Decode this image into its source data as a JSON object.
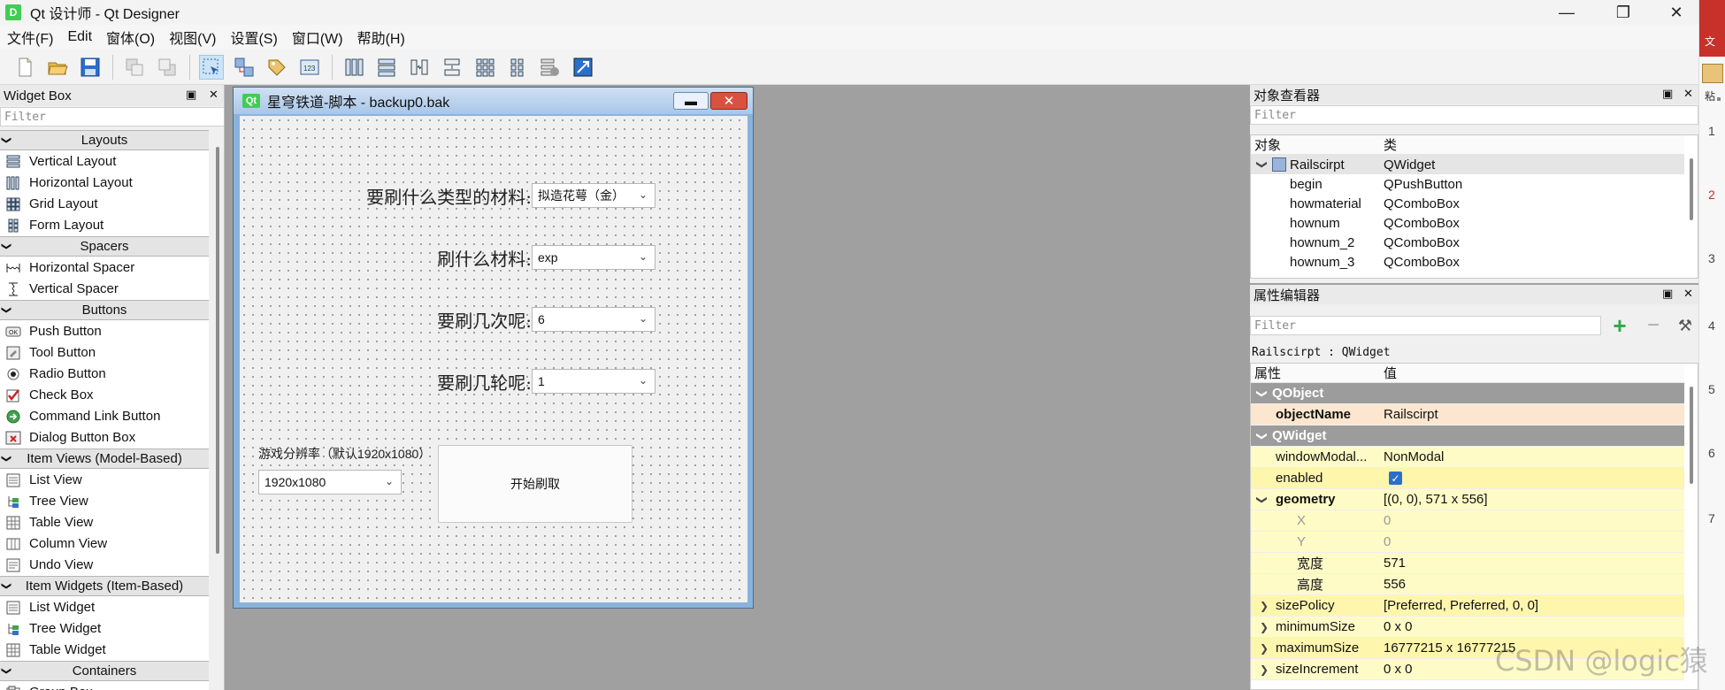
{
  "window": {
    "app_icon": "D",
    "title": "Qt 设计师 - Qt Designer",
    "minimize": "—",
    "restore": "❐",
    "close": "✕"
  },
  "menu": [
    "文件(F)",
    "Edit",
    "窗体(O)",
    "视图(V)",
    "设置(S)",
    "窗口(W)",
    "帮助(H)"
  ],
  "toolbar": {
    "icons": [
      "new-form-icon",
      "open-icon",
      "save-icon",
      "send-to-back-icon",
      "bring-to-front-icon",
      "edit-widgets-icon",
      "edit-signals-slots-icon",
      "edit-buddies-icon",
      "edit-tab-order-icon",
      "layout-horizontal-icon",
      "layout-vertical-icon",
      "layout-h-splitter-icon",
      "layout-v-splitter-icon",
      "layout-grid-icon",
      "layout-form-icon",
      "break-layout-icon",
      "adjust-size-icon"
    ]
  },
  "widget_box": {
    "title": "Widget Box",
    "filter_placeholder": "Filter",
    "float_icon": "▣",
    "close_icon": "✕",
    "rows": [
      {
        "type": "cat",
        "label": "Layouts"
      },
      {
        "type": "item",
        "label": "Vertical Layout",
        "icon": "vertical-layout-icon"
      },
      {
        "type": "item",
        "label": "Horizontal Layout",
        "icon": "horizontal-layout-icon"
      },
      {
        "type": "item",
        "label": "Grid Layout",
        "icon": "grid-layout-icon"
      },
      {
        "type": "item",
        "label": "Form Layout",
        "icon": "form-layout-icon"
      },
      {
        "type": "cat",
        "label": "Spacers"
      },
      {
        "type": "item",
        "label": "Horizontal Spacer",
        "icon": "horizontal-spacer-icon"
      },
      {
        "type": "item",
        "label": "Vertical Spacer",
        "icon": "vertical-spacer-icon"
      },
      {
        "type": "cat",
        "label": "Buttons"
      },
      {
        "type": "item",
        "label": "Push Button",
        "icon": "push-button-icon"
      },
      {
        "type": "item",
        "label": "Tool Button",
        "icon": "tool-button-icon"
      },
      {
        "type": "item",
        "label": "Radio Button",
        "icon": "radio-button-icon"
      },
      {
        "type": "item",
        "label": "Check Box",
        "icon": "check-box-icon"
      },
      {
        "type": "item",
        "label": "Command Link Button",
        "icon": "command-link-icon"
      },
      {
        "type": "item",
        "label": "Dialog Button Box",
        "icon": "dialog-button-box-icon"
      },
      {
        "type": "cat",
        "label": "Item Views (Model-Based)"
      },
      {
        "type": "item",
        "label": "List View",
        "icon": "list-view-icon"
      },
      {
        "type": "item",
        "label": "Tree View",
        "icon": "tree-view-icon"
      },
      {
        "type": "item",
        "label": "Table View",
        "icon": "table-view-icon"
      },
      {
        "type": "item",
        "label": "Column View",
        "icon": "column-view-icon"
      },
      {
        "type": "item",
        "label": "Undo View",
        "icon": "undo-view-icon"
      },
      {
        "type": "cat",
        "label": "Item Widgets (Item-Based)"
      },
      {
        "type": "item",
        "label": "List Widget",
        "icon": "list-widget-icon"
      },
      {
        "type": "item",
        "label": "Tree Widget",
        "icon": "tree-widget-icon"
      },
      {
        "type": "item",
        "label": "Table Widget",
        "icon": "table-widget-icon"
      },
      {
        "type": "cat",
        "label": "Containers"
      },
      {
        "type": "item",
        "label": "Group Box",
        "icon": "group-box-icon"
      }
    ]
  },
  "form": {
    "qt_badge": "Qt",
    "title": "星穹铁道-脚本 - backup0.bak",
    "labels": {
      "material_type": "要刷什么类型的材料:",
      "material": "刷什么材料:",
      "times": "要刷几次呢:",
      "rounds": "要刷几轮呢:",
      "resolution": "游戏分辨率（默认1920x1080）"
    },
    "combos": {
      "material_type": "拟造花萼（金）",
      "material": "exp",
      "times": "6",
      "rounds": "1",
      "resolution": "1920x1080"
    },
    "start_button": "开始刷取"
  },
  "object_inspector": {
    "title": "对象查看器",
    "filter_placeholder": "Filter",
    "col_object": "对象",
    "col_class": "类",
    "rows": [
      {
        "object": "Railscirpt",
        "class": "QWidget"
      },
      {
        "object": "begin",
        "class": "QPushButton"
      },
      {
        "object": "howmaterial",
        "class": "QComboBox"
      },
      {
        "object": "hownum",
        "class": "QComboBox"
      },
      {
        "object": "hownum_2",
        "class": "QComboBox"
      },
      {
        "object": "hownum_3",
        "class": "QComboBox"
      }
    ]
  },
  "property_editor": {
    "title": "属性编辑器",
    "filter_placeholder": "Filter",
    "context": "Railscirpt : QWidget",
    "col_property": "属性",
    "col_value": "值",
    "rows": [
      {
        "kind": "group",
        "name": "QObject",
        "value": ""
      },
      {
        "kind": "sel",
        "name": "objectName",
        "value": "Railscirpt"
      },
      {
        "kind": "group",
        "name": "QWidget",
        "value": ""
      },
      {
        "kind": "prop",
        "name": "windowModal...",
        "value": "NonModal"
      },
      {
        "kind": "check",
        "name": "enabled",
        "value": "✓"
      },
      {
        "kind": "prop-open",
        "name": "geometry",
        "value": "[(0, 0), 571 x 556]"
      },
      {
        "kind": "sub-dim",
        "name": "X",
        "value": "0"
      },
      {
        "kind": "sub-dim",
        "name": "Y",
        "value": "0"
      },
      {
        "kind": "sub",
        "name": "宽度",
        "value": "571"
      },
      {
        "kind": "sub",
        "name": "高度",
        "value": "556"
      },
      {
        "kind": "prop-closed",
        "name": "sizePolicy",
        "value": "[Preferred, Preferred, 0, 0]"
      },
      {
        "kind": "prop-closed",
        "name": "minimumSize",
        "value": "0 x 0"
      },
      {
        "kind": "prop-closed",
        "name": "maximumSize",
        "value": "16777215 x 16777215"
      },
      {
        "kind": "prop-closed",
        "name": "sizeIncrement",
        "value": "0 x 0"
      }
    ]
  },
  "right_strip": {
    "labels": [
      "文",
      "粘"
    ],
    "line_numbers": [
      "1",
      "2",
      "3",
      "4",
      "5",
      "6",
      "7"
    ]
  },
  "watermark": "CSDN @logic猿"
}
